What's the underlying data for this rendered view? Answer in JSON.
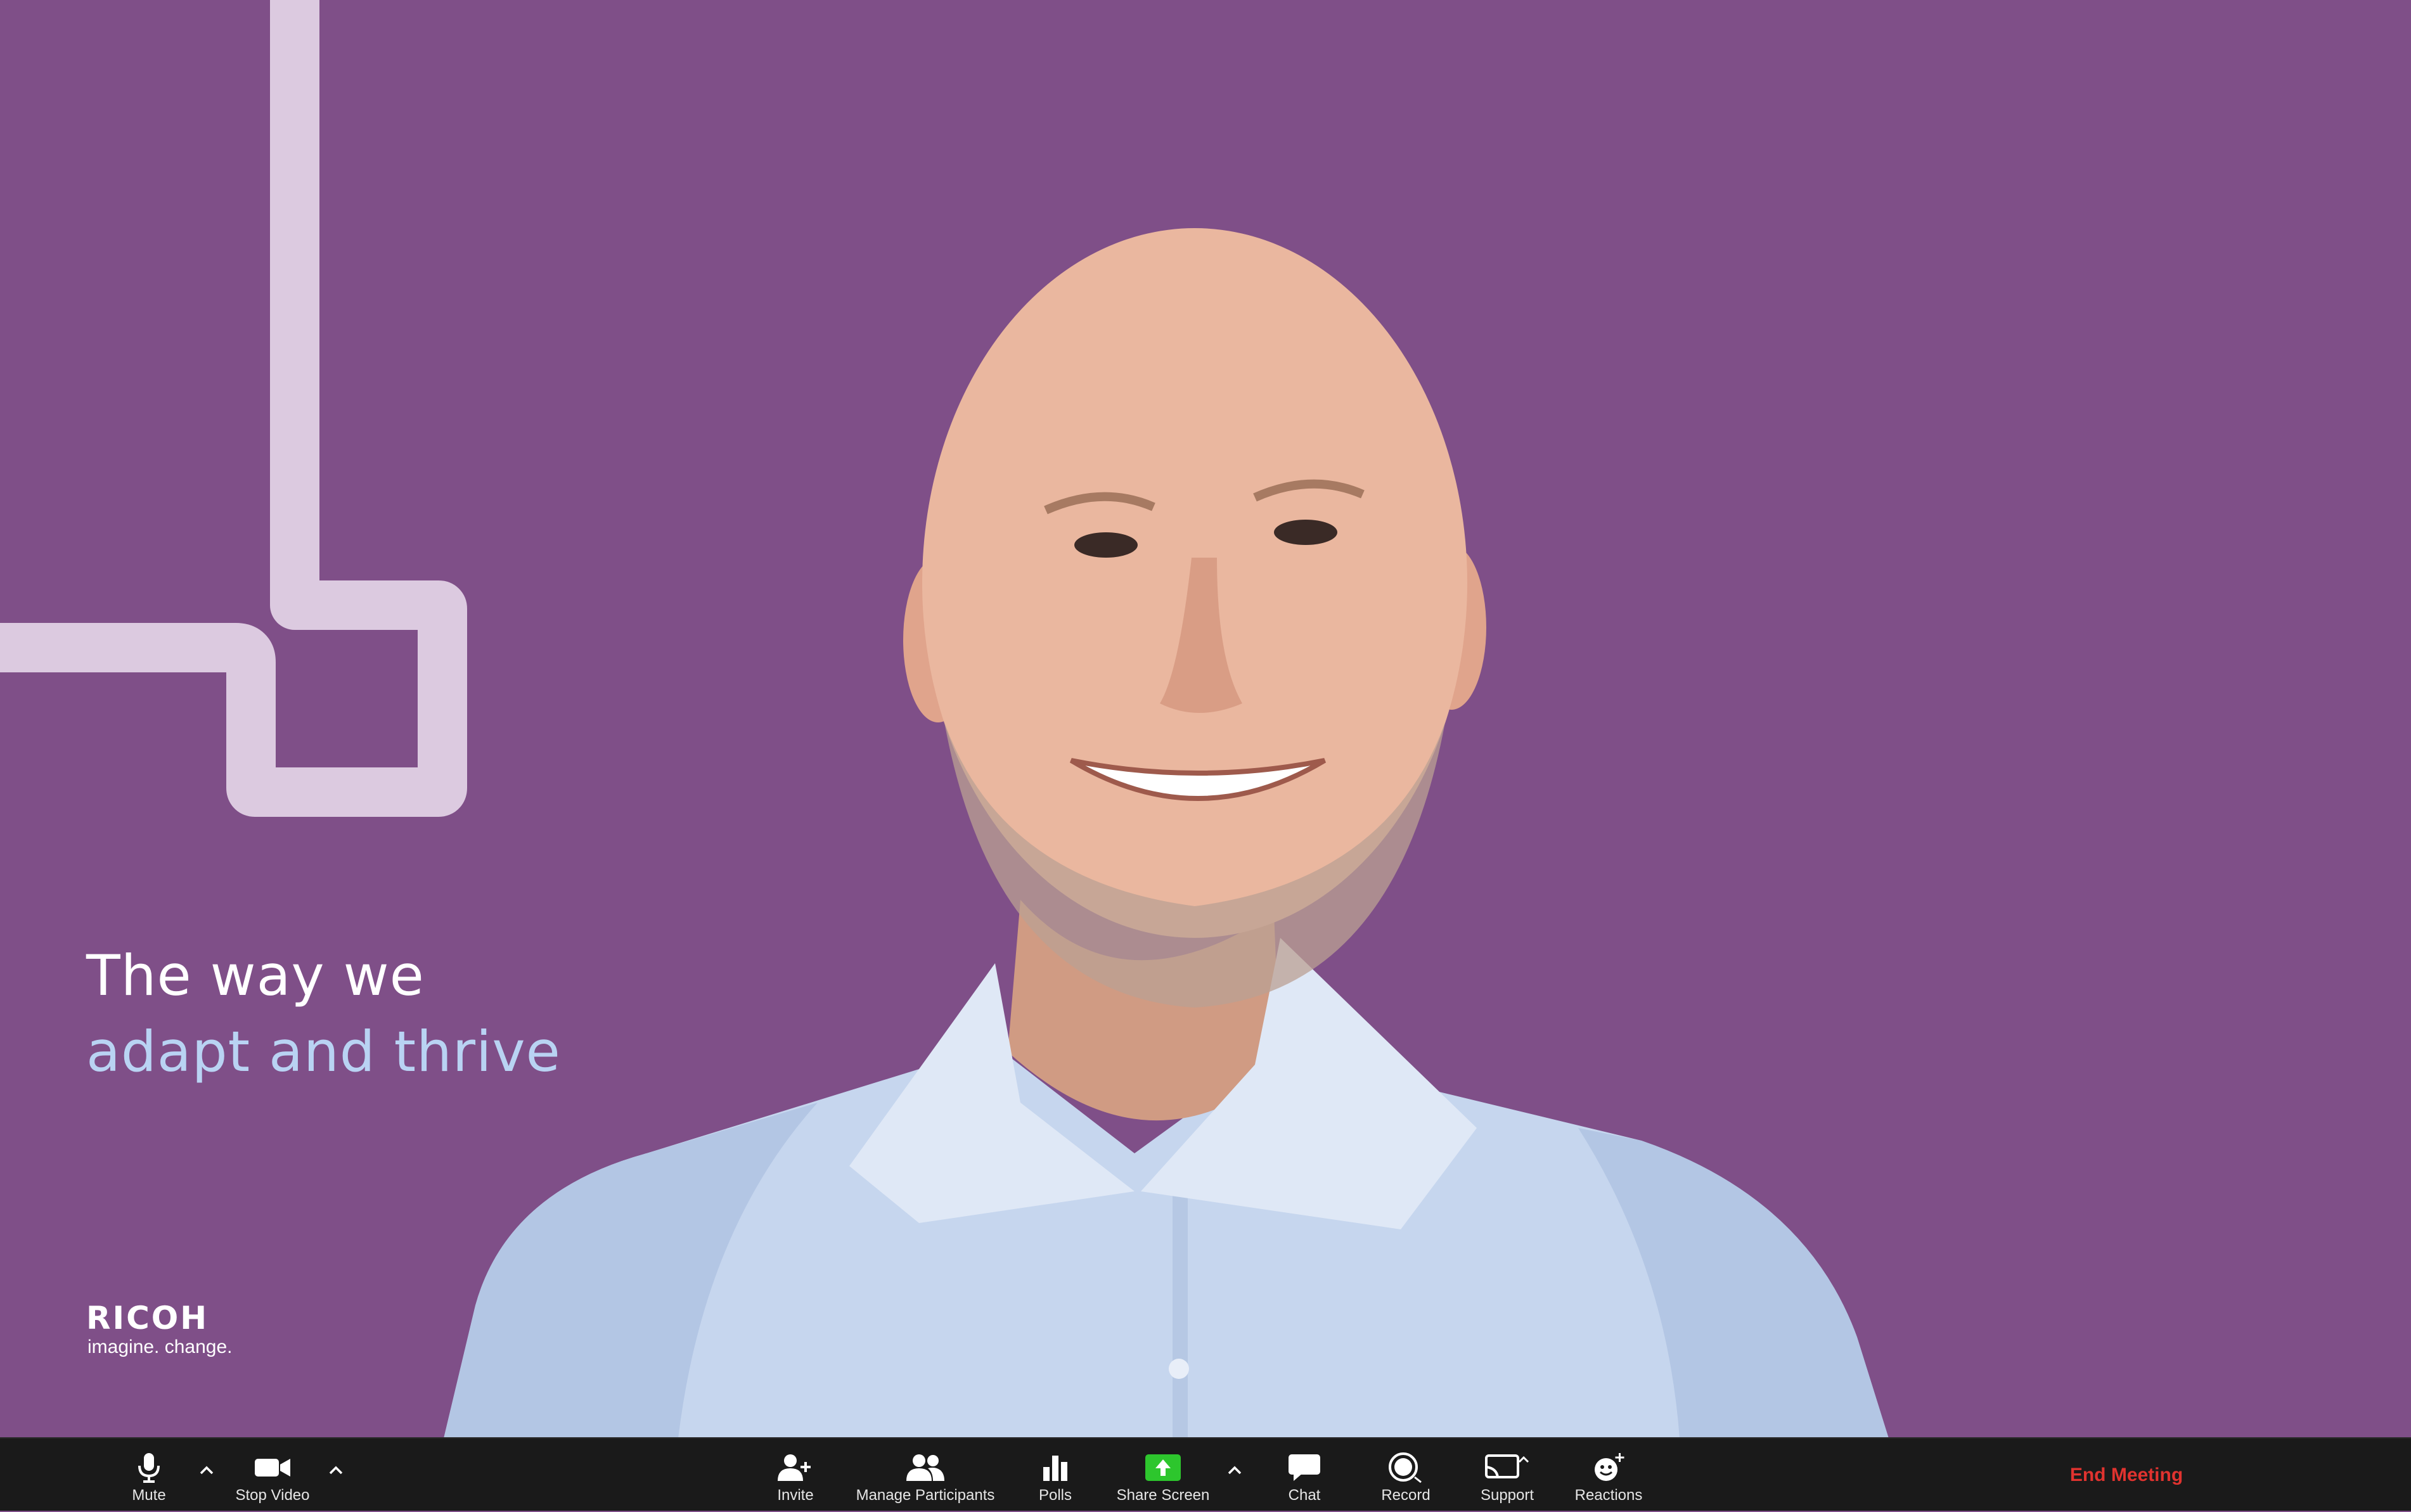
{
  "background": {
    "color": "#7f4f88",
    "deco_color": "#dccae0"
  },
  "headline": {
    "line1": "The way we",
    "line2": "adapt and thrive"
  },
  "brand": {
    "logo_text": "RICOH",
    "tagline": "imagine. change."
  },
  "toolbar": {
    "mute_label": "Mute",
    "stop_video_label": "Stop Video",
    "invite_label": "Invite",
    "participants_label": "Manage Participants",
    "polls_label": "Polls",
    "share_label": "Share Screen",
    "chat_label": "Chat",
    "record_label": "Record",
    "support_label": "Support",
    "reactions_label": "Reactions",
    "end_label": "End Meeting",
    "share_color": "#2dc62d",
    "end_color": "#e0332f"
  },
  "icons": {
    "mute": "microphone-icon",
    "video": "video-camera-icon",
    "invite": "add-person-icon",
    "participants": "people-icon",
    "polls": "bar-chart-icon",
    "share": "share-screen-arrow-icon",
    "chat": "chat-bubble-icon",
    "record": "record-icon",
    "support": "support-icon",
    "reactions": "add-emoji-icon",
    "caret": "chevron-up-icon"
  }
}
